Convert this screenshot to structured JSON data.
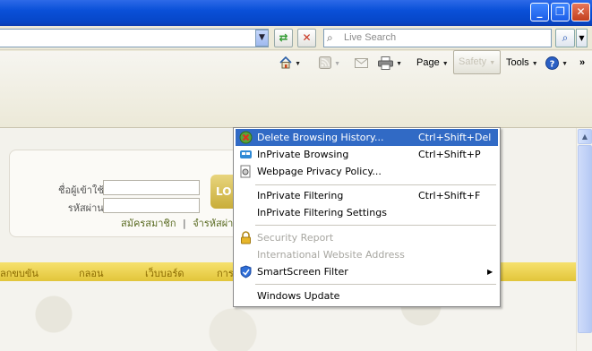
{
  "window": {
    "minimize_icon": "minimize-icon",
    "restore_icon": "restore-icon",
    "close_icon": "close-icon"
  },
  "address_bar": {
    "search_placeholder": "Live Search"
  },
  "command_bar": {
    "page_label": "Page",
    "safety_label": "Safety",
    "tools_label": "Tools",
    "more_label": "»"
  },
  "page_content": {
    "username_label": "ชื่อผู้เข้าใช้ :",
    "password_label": "รหัสผ่าน :",
    "login_button": "LO",
    "register_link": "สมัครสมาชิก",
    "link_separator": "|",
    "forgot_link": "จำรหัสผ่าน",
    "nav_items": [
      "ลกขบขัน",
      "กลอน",
      "เว็บบอร์ด",
      "การ"
    ]
  },
  "safety_menu": {
    "items": [
      {
        "label": "Delete Browsing History...",
        "shortcut": "Ctrl+Shift+Del"
      },
      {
        "label": "InPrivate Browsing",
        "shortcut": "Ctrl+Shift+P"
      },
      {
        "label": "Webpage Privacy Policy...",
        "shortcut": ""
      },
      {
        "label": "InPrivate Filtering",
        "shortcut": "Ctrl+Shift+F"
      },
      {
        "label": "InPrivate Filtering Settings",
        "shortcut": ""
      },
      {
        "label": "Security Report",
        "shortcut": ""
      },
      {
        "label": "International Website Address",
        "shortcut": ""
      },
      {
        "label": "SmartScreen Filter",
        "shortcut": ""
      },
      {
        "label": "Windows Update",
        "shortcut": ""
      }
    ]
  },
  "colors": {
    "titlebar": "#0a50d8",
    "menu_highlight": "#316ac5",
    "nav_strip": "#e2c53a"
  }
}
